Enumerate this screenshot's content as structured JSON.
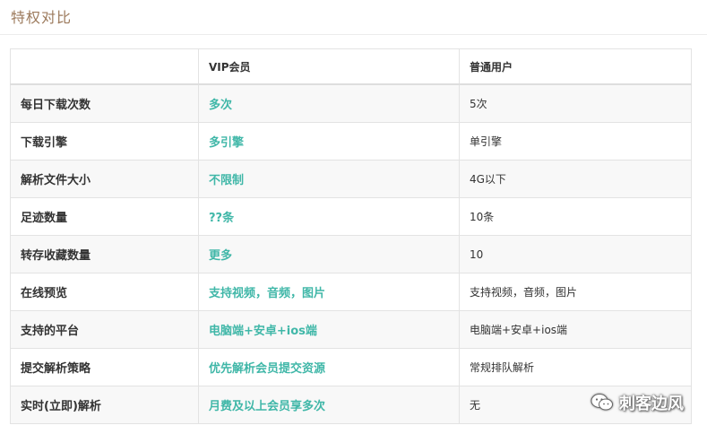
{
  "header": {
    "title": "特权对比"
  },
  "table": {
    "columns": [
      "",
      "VIP会员",
      "普通用户"
    ],
    "rows": [
      {
        "feature": "每日下载次数",
        "vip": "多次",
        "normal": "5次"
      },
      {
        "feature": "下载引擎",
        "vip": "多引擎",
        "normal": "单引擎"
      },
      {
        "feature": "解析文件大小",
        "vip": "不限制",
        "normal": "4G以下"
      },
      {
        "feature": "足迹数量",
        "vip": "??条",
        "normal": "10条"
      },
      {
        "feature": "转存收藏数量",
        "vip": "更多",
        "normal": "10"
      },
      {
        "feature": "在线预览",
        "vip": "支持视频，音频，图片",
        "normal": "支持视频，音频，图片"
      },
      {
        "feature": "支持的平台",
        "vip": "电脑端+安卓+ios端",
        "normal": "电脑端+安卓+ios端"
      },
      {
        "feature": "提交解析策略",
        "vip": "优先解析会员提交资源",
        "normal": "常规排队解析"
      },
      {
        "feature": "实时(立即)解析",
        "vip": "月费及以上会员享多次",
        "normal": "无"
      }
    ]
  },
  "watermark": {
    "text": "刺客边风",
    "icon": "wechat-icon"
  },
  "colors": {
    "accent": "#40b7a8",
    "title": "#9c7a5c"
  }
}
